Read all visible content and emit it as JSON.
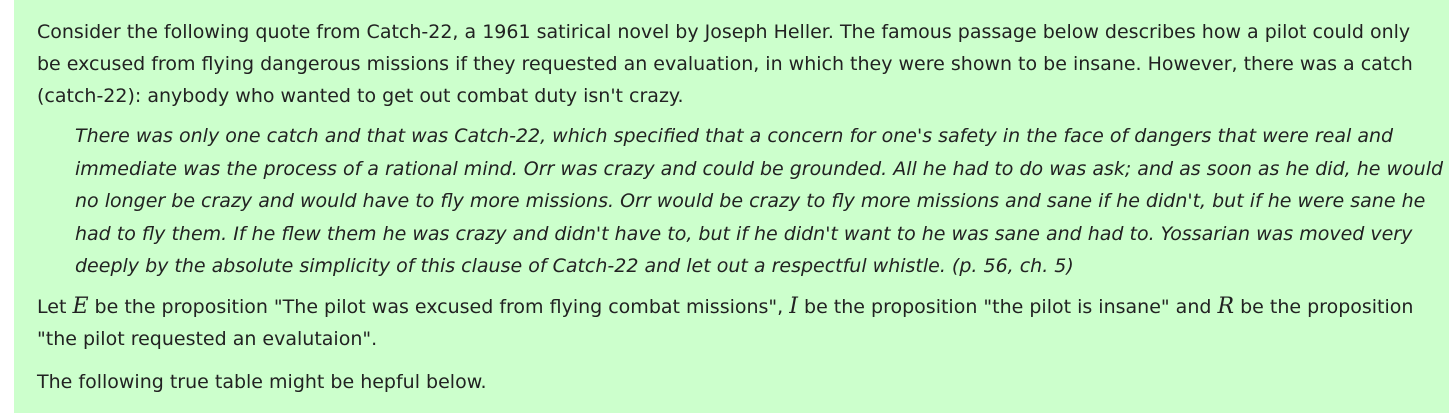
{
  "intro": "Consider the following quote from Catch-22, a 1961 satirical novel by Joseph Heller. The famous passage below describes how a pilot could only be excused from flying dangerous missions if they requested an evaluation, in which they were shown to be insane. However, there was a catch (catch-22): anybody who wanted to get out combat duty isn't crazy.",
  "quote": "There was only one catch and that was Catch-22, which specified that a concern for one's safety in the face of dangers that were real and immediate was the process of a rational mind. Orr was crazy and could be grounded. All he had to do was ask; and as soon as he did, he would no longer be crazy and would have to fly more missions. Orr would be crazy to fly more missions and sane if he didn't, but if he were sane he had to fly them. If he flew them he was crazy and didn't have to, but if he didn't want to he was sane and had to. Yossarian was moved very deeply by the absolute simplicity of this clause of Catch-22 and let out a respectful whistle. (p. 56, ch. 5)",
  "definitions": {
    "let": "Let",
    "var_e": "E",
    "def_e": "be the proposition \"The pilot was excused from flying combat missions\",",
    "var_i": "I",
    "def_i": "be the proposition \"the pilot is insane\" and",
    "var_r": "R",
    "def_r": "be the proposition \"the pilot requested an evalutaion\"."
  },
  "table_note": "The following true table might be hepful below."
}
